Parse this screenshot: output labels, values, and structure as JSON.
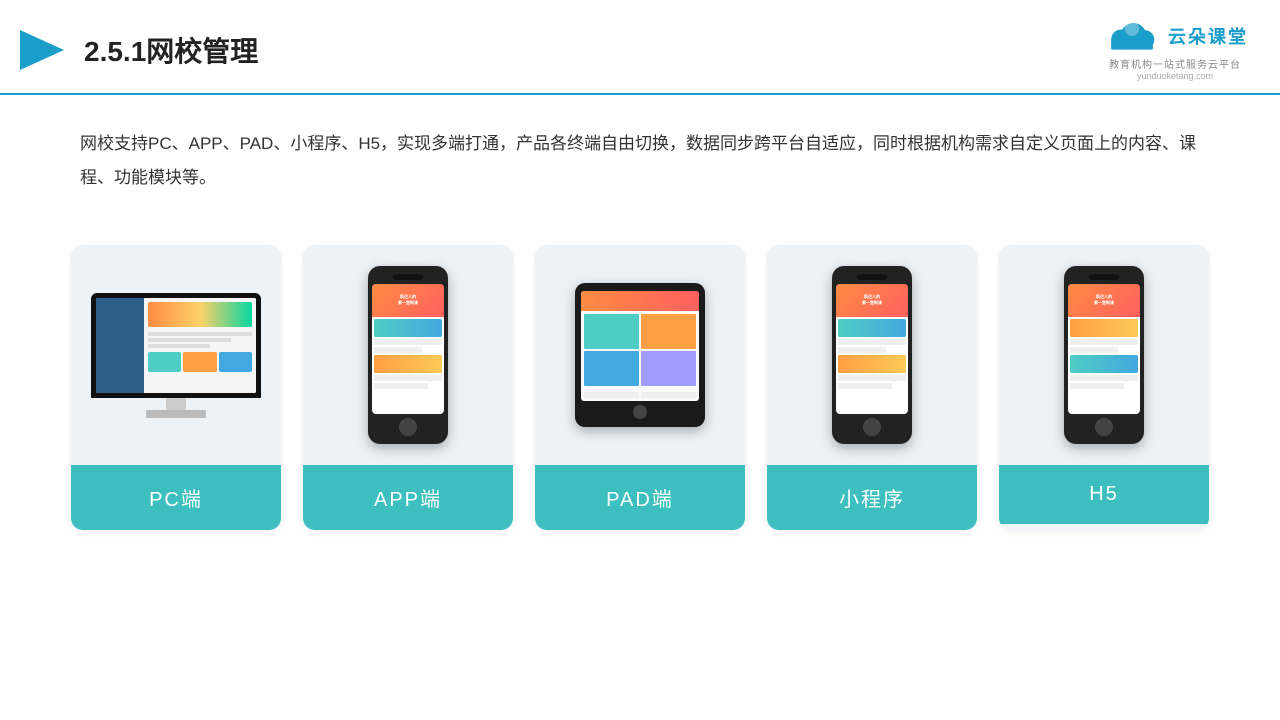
{
  "header": {
    "title": "2.5.1网校管理",
    "logo_text": "云朵课堂",
    "logo_url": "yunduoketang.com",
    "logo_tagline": "教育机构一站式服务云平台"
  },
  "description": {
    "text": "网校支持PC、APP、PAD、小程序、H5，实现多端打通，产品各终端自由切换，数据同步跨平台自适应，同时根据机构需求自定义页面上的内容、课程、功能模块等。"
  },
  "cards": [
    {
      "id": "pc",
      "label": "PC端"
    },
    {
      "id": "app",
      "label": "APP端"
    },
    {
      "id": "pad",
      "label": "PAD端"
    },
    {
      "id": "miniprogram",
      "label": "小程序"
    },
    {
      "id": "h5",
      "label": "H5"
    }
  ],
  "colors": {
    "accent": "#1a9ec9",
    "card_label_bg": "#3dbfbf",
    "header_border": "#1a9ec9"
  }
}
